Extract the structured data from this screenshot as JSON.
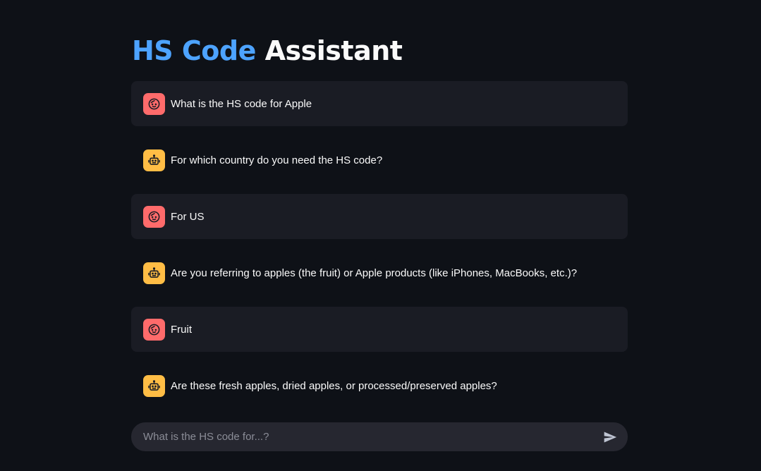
{
  "header": {
    "title_accent": "HS Code",
    "title_rest": "Assistant",
    "accent_color": "#4da3ff"
  },
  "messages": [
    {
      "role": "user",
      "icon": "face-icon",
      "text": "What is the HS code for Apple"
    },
    {
      "role": "assistant",
      "icon": "robot-icon",
      "text": "For which country do you need the HS code?"
    },
    {
      "role": "user",
      "icon": "face-icon",
      "text": "For US"
    },
    {
      "role": "assistant",
      "icon": "robot-icon",
      "text": "Are you referring to apples (the fruit) or Apple products (like iPhones, MacBooks, etc.)?"
    },
    {
      "role": "user",
      "icon": "face-icon",
      "text": "Fruit"
    },
    {
      "role": "assistant",
      "icon": "robot-icon",
      "text": "Are these fresh apples, dried apples, or processed/preserved apples?"
    }
  ],
  "chat_input": {
    "placeholder": "What is the HS code for...?",
    "value": "",
    "send_icon": "send-icon"
  },
  "colors": {
    "background": "#0e1117",
    "user_bubble": "#1a1c24",
    "user_avatar": "#ff6b6b",
    "assistant_avatar": "#ffbd45",
    "input_background": "#262730"
  }
}
